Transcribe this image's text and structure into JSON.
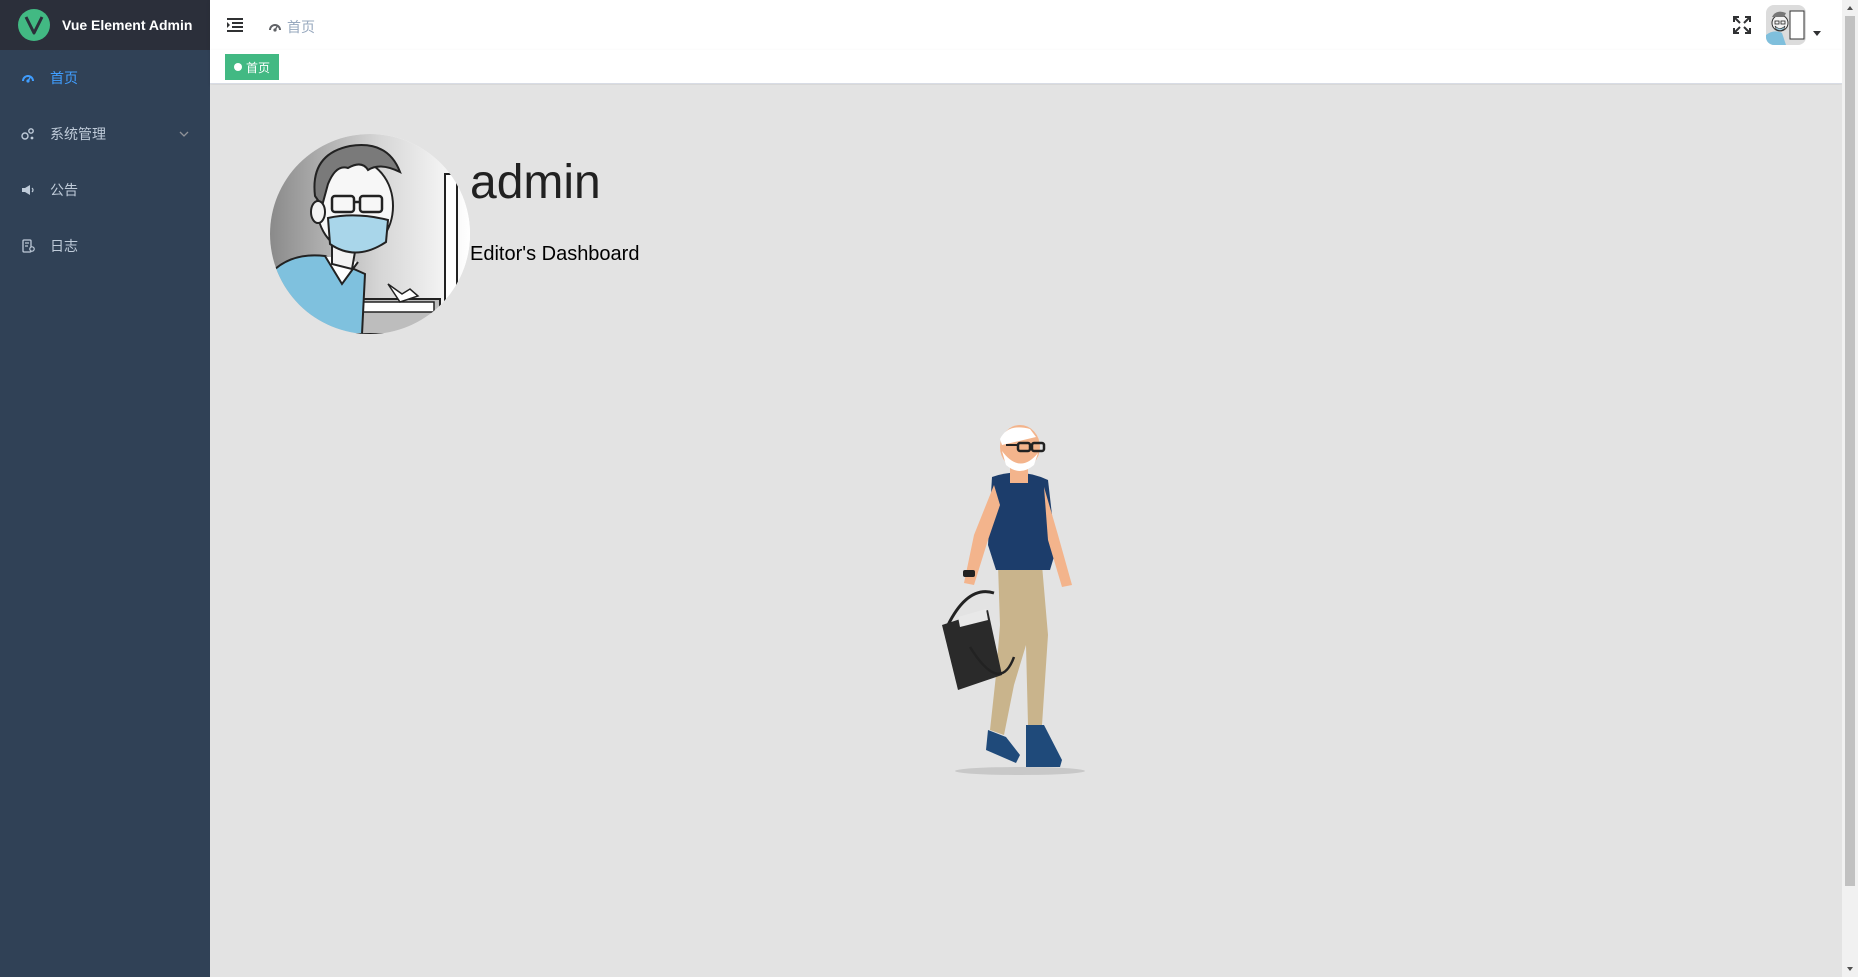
{
  "app": {
    "title": "Vue Element Admin",
    "brand_color": "#42b983",
    "sidebar_bg": "#304156",
    "accent": "#409eff"
  },
  "sidebar": {
    "items": [
      {
        "label": "首页",
        "icon": "dashboard-icon",
        "active": true
      },
      {
        "label": "系统管理",
        "icon": "settings-icon",
        "has_children": true
      },
      {
        "label": "公告",
        "icon": "megaphone-icon"
      },
      {
        "label": "日志",
        "icon": "log-icon"
      }
    ]
  },
  "navbar": {
    "breadcrumb": "首页",
    "breadcrumb_icon": "dashboard-icon"
  },
  "tags_view": {
    "tags": [
      {
        "label": "首页",
        "active": true
      }
    ]
  },
  "dashboard": {
    "name": "admin",
    "role": "Editor's Dashboard"
  }
}
